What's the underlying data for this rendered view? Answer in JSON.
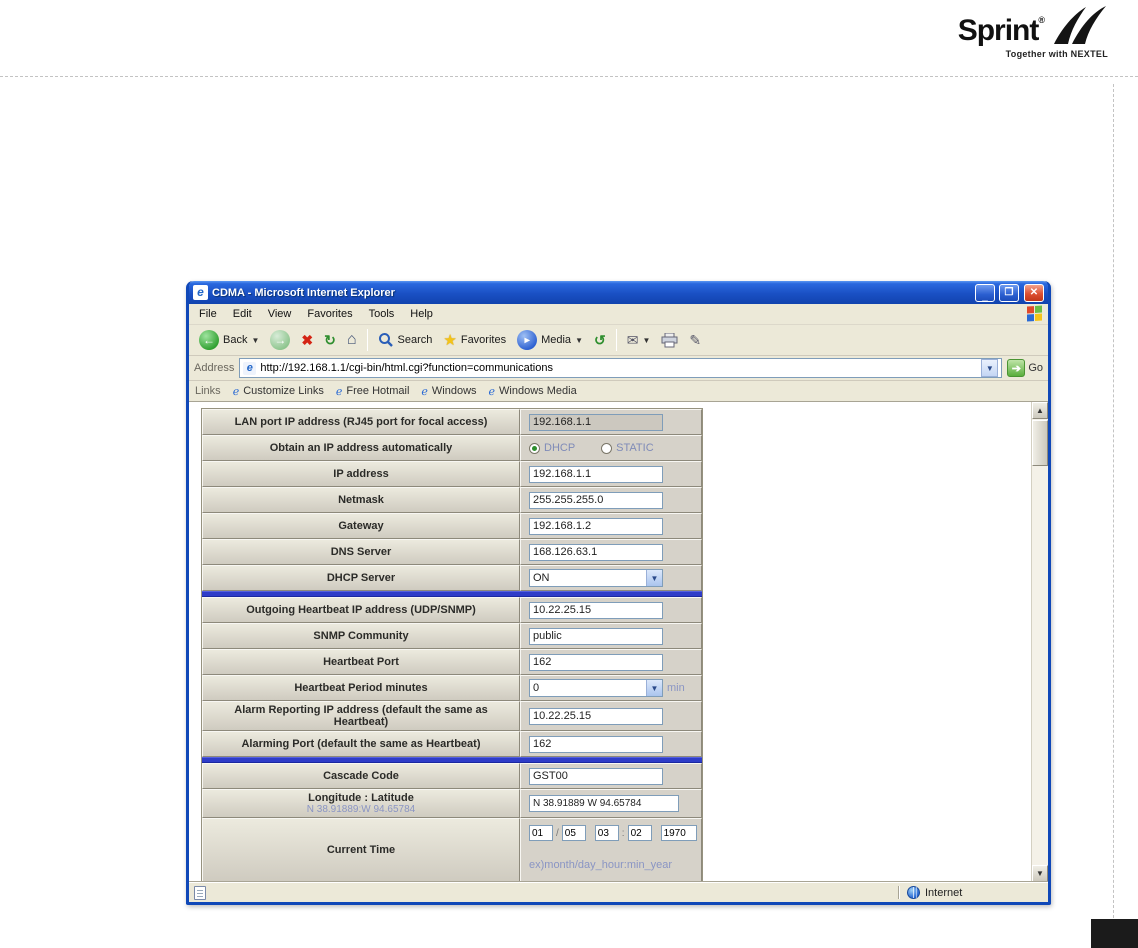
{
  "brand": {
    "name": "Sprint",
    "reg": "®",
    "tagline": "Together with NEXTEL"
  },
  "ie": {
    "title": "CDMA - Microsoft Internet Explorer",
    "menu_items": [
      "File",
      "Edit",
      "View",
      "Favorites",
      "Tools",
      "Help"
    ],
    "toolbar": {
      "back": "Back",
      "search": "Search",
      "favorites": "Favorites",
      "media": "Media"
    },
    "address_label": "Address",
    "address_value": "http://192.168.1.1/cgi-bin/html.cgi?function=communications",
    "go_label": "Go",
    "links_label": "Links",
    "links": [
      "Customize Links",
      "Free Hotmail",
      "Windows",
      "Windows Media"
    ],
    "status_right": "Internet"
  },
  "form": {
    "lan_ip": {
      "label": "LAN port IP address (RJ45 port for focal access)",
      "value": "192.168.1.1"
    },
    "obtain": {
      "label": "Obtain an IP address automatically",
      "options": [
        "DHCP",
        "STATIC"
      ],
      "selected": "DHCP"
    },
    "ip": {
      "label": "IP address",
      "value": "192.168.1.1"
    },
    "netmask": {
      "label": "Netmask",
      "value": "255.255.255.0"
    },
    "gateway": {
      "label": "Gateway",
      "value": "192.168.1.2"
    },
    "dns": {
      "label": "DNS Server",
      "value": "168.126.63.1"
    },
    "dhcp_server": {
      "label": "DHCP Server",
      "value": "ON"
    },
    "heartbeat_ip": {
      "label": "Outgoing Heartbeat IP address (UDP/SNMP)",
      "value": "10.22.25.15"
    },
    "snmp": {
      "label": "SNMP Community",
      "value": "public"
    },
    "hb_port": {
      "label": "Heartbeat Port",
      "value": "162"
    },
    "hb_period": {
      "label": "Heartbeat Period minutes",
      "value": "0",
      "suffix": "min"
    },
    "alarm_ip": {
      "label": "Alarm Reporting IP address (default the same as Heartbeat)",
      "value": "10.22.25.15"
    },
    "alarm_port": {
      "label": "Alarming Port (default the same as Heartbeat)",
      "value": "162"
    },
    "cascade": {
      "label": "Cascade Code",
      "value": "GST00"
    },
    "longlat": {
      "label": "Longitude : Latitude",
      "sublabel": "N 38.91889:W 94.65784",
      "value": "N 38.91889 W 94.65784"
    },
    "current_time": {
      "label": "Current Time",
      "month": "01",
      "day": "05",
      "hour": "03",
      "min": "02",
      "year": "1970",
      "sep1": "/",
      "sep2": ":",
      "hint": "ex)month/day_hour:min_year"
    }
  }
}
